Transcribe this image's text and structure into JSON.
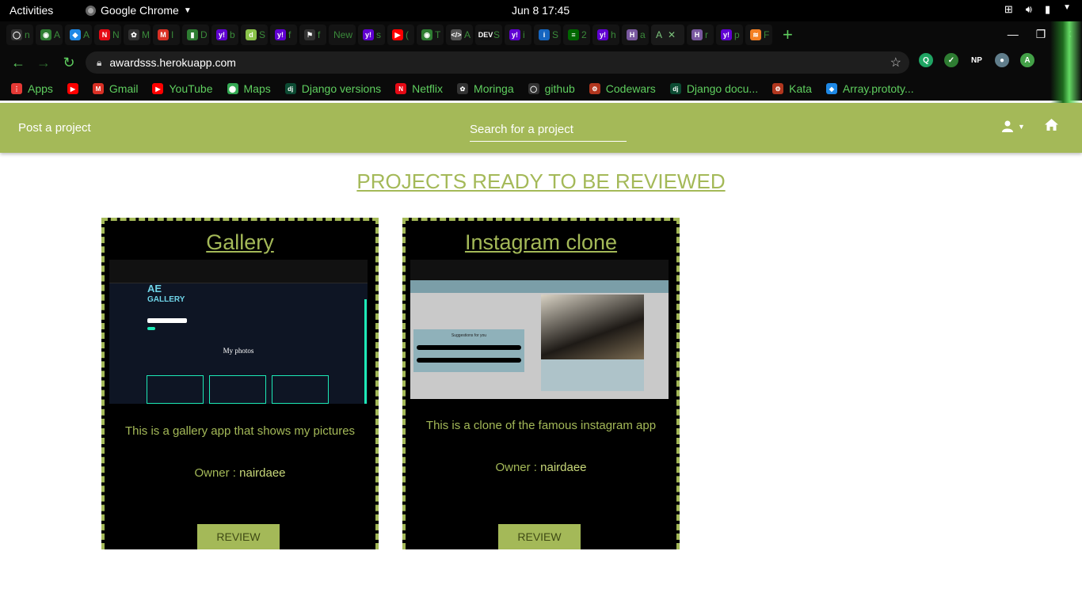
{
  "system": {
    "activities": "Activities",
    "app_name": "Google Chrome",
    "clock": "Jun 8  17:45"
  },
  "browser": {
    "url": "awardsss.herokuapp.com",
    "tabs": [
      {
        "label": "n",
        "color": "#333333",
        "glyph": "◯"
      },
      {
        "label": "A",
        "color": "#2e7d32",
        "glyph": "◉"
      },
      {
        "label": "A",
        "color": "#1e88e5",
        "glyph": "◆"
      },
      {
        "label": "N",
        "color": "#e50914",
        "glyph": "N"
      },
      {
        "label": "M",
        "color": "#333333",
        "glyph": "✿"
      },
      {
        "label": "I",
        "color": "#d93025",
        "glyph": "M"
      },
      {
        "label": "D",
        "color": "#2e7d32",
        "glyph": "▮"
      },
      {
        "label": "b",
        "color": "#6001d2",
        "glyph": "y!"
      },
      {
        "label": "S",
        "color": "#8bc34a",
        "glyph": "d"
      },
      {
        "label": "f",
        "color": "#6001d2",
        "glyph": "y!"
      },
      {
        "label": "f",
        "color": "#333333",
        "glyph": "⚑"
      },
      {
        "label": "New",
        "color": "#0a0a0a",
        "glyph": ""
      },
      {
        "label": "s",
        "color": "#6001d2",
        "glyph": "y!"
      },
      {
        "label": "(",
        "color": "#ff0000",
        "glyph": "▶"
      },
      {
        "label": "T",
        "color": "#2e7d32",
        "glyph": "◉"
      },
      {
        "label": "A",
        "color": "#555555",
        "glyph": "</>"
      },
      {
        "label": "S",
        "color": "#111111",
        "glyph": "DEV"
      },
      {
        "label": "i",
        "color": "#6001d2",
        "glyph": "y!"
      },
      {
        "label": "S",
        "color": "#1565c0",
        "glyph": "i"
      },
      {
        "label": "2",
        "color": "#006600",
        "glyph": "≡"
      },
      {
        "label": "h",
        "color": "#6001d2",
        "glyph": "y!"
      },
      {
        "label": "a",
        "color": "#79589f",
        "glyph": "H"
      },
      {
        "label": "A",
        "color": "#1a1a1a",
        "glyph": ""
      },
      {
        "label": "r",
        "color": "#79589f",
        "glyph": "H"
      },
      {
        "label": "p",
        "color": "#6001d2",
        "glyph": "y!"
      },
      {
        "label": "F",
        "color": "#f48024",
        "glyph": "≋"
      }
    ],
    "extensions": [
      {
        "glyph": "Q",
        "color": "#1fa463"
      },
      {
        "glyph": "✓",
        "color": "#2e7d32"
      },
      {
        "glyph": "NP",
        "color": "#0a0a0a"
      },
      {
        "glyph": "●",
        "color": "#607d8b"
      },
      {
        "glyph": "A",
        "color": "#43a047"
      }
    ],
    "bookmarks": [
      {
        "label": "Apps",
        "color": "#e53935",
        "glyph": "⋮"
      },
      {
        "label": "",
        "color": "#ff0000",
        "glyph": "▶"
      },
      {
        "label": "Gmail",
        "color": "#d93025",
        "glyph": "M"
      },
      {
        "label": "YouTube",
        "color": "#ff0000",
        "glyph": "▶"
      },
      {
        "label": "Maps",
        "color": "#34a853",
        "glyph": "⬤"
      },
      {
        "label": "Django versions",
        "color": "#0c4b33",
        "glyph": "dj"
      },
      {
        "label": "Netflix",
        "color": "#e50914",
        "glyph": "N"
      },
      {
        "label": "Moringa",
        "color": "#333333",
        "glyph": "✿"
      },
      {
        "label": "github",
        "color": "#333333",
        "glyph": "◯"
      },
      {
        "label": "Codewars",
        "color": "#b1361e",
        "glyph": "⚙"
      },
      {
        "label": "Django docu...",
        "color": "#0c4b33",
        "glyph": "dj"
      },
      {
        "label": "Kata",
        "color": "#b1361e",
        "glyph": "⚙"
      },
      {
        "label": "Array.prototy...",
        "color": "#1e88e5",
        "glyph": "◆"
      }
    ]
  },
  "navbar": {
    "post_label": "Post a project",
    "search_placeholder": "Search for a project",
    "accent": "#a4b958"
  },
  "page": {
    "heading": "PROJECTS READY TO BE REVIEWED",
    "projects": [
      {
        "title": "Gallery",
        "description": "This is a gallery app that shows my pictures",
        "owner_label": "Owner : ",
        "owner": "nairdaee",
        "review_label": "REVIEW",
        "preview": {
          "logo_top": "AE",
          "logo_bottom": "GALLERY",
          "section": "My photos"
        }
      },
      {
        "title": "Instagram clone",
        "description": "This is a clone of the famous instagram app",
        "owner_label": "Owner : ",
        "owner": "nairdaee",
        "review_label": "REVIEW",
        "preview": {
          "suggestions": "Suggestions for you"
        }
      }
    ]
  }
}
